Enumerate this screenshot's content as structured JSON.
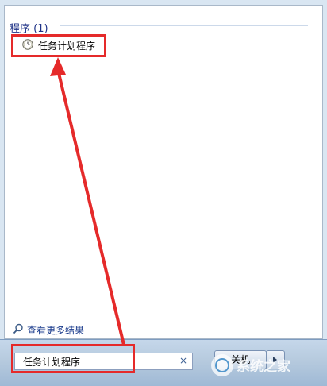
{
  "section": {
    "title": "程序 (1)"
  },
  "results": [
    {
      "label": "任务计划程序",
      "icon": "clock-icon"
    }
  ],
  "see_more": {
    "label": "查看更多结果",
    "icon": "search-icon"
  },
  "search": {
    "value": "任务计划程序",
    "clear_icon": "×"
  },
  "shutdown": {
    "label": "关机"
  },
  "watermark": {
    "text": "系统之家"
  },
  "colors": {
    "highlight": "#e52a2a",
    "section_title": "#1e3287",
    "bar": "#b6cade"
  }
}
